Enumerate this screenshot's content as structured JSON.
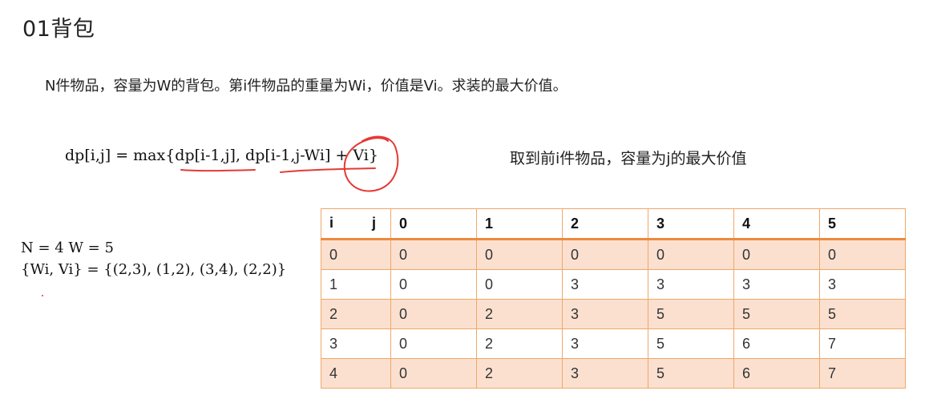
{
  "title": "01背包",
  "description": "N件物品，容量为W的背包。第i件物品的重量为Wi，价值是Vi。求装的最大价值。",
  "formula": "dp[i,j] = max{dp[i-1,j], dp[i-1,j-Wi] + Vi}",
  "formula_note": "取到前i件物品，容量为j的最大价值",
  "given": {
    "line1": "N = 4 W = 5",
    "line2": "{Wi, Vi} = {(2,3), (1,2), (3,4), (2,2)}"
  },
  "colors": {
    "annotation": "#e53935",
    "table_border": "#f0a868",
    "table_header_rule": "#ee8a3c",
    "table_band": "#fbe0d0"
  },
  "table": {
    "row_header": "i",
    "col_header": "j",
    "columns": [
      "0",
      "1",
      "2",
      "3",
      "4",
      "5"
    ],
    "rows": [
      [
        "0",
        "0",
        "0",
        "0",
        "0",
        "0",
        "0"
      ],
      [
        "1",
        "0",
        "0",
        "3",
        "3",
        "3",
        "3"
      ],
      [
        "2",
        "0",
        "2",
        "3",
        "5",
        "5",
        "5"
      ],
      [
        "3",
        "0",
        "2",
        "3",
        "5",
        "6",
        "7"
      ],
      [
        "4",
        "0",
        "2",
        "3",
        "5",
        "6",
        "7"
      ]
    ]
  }
}
